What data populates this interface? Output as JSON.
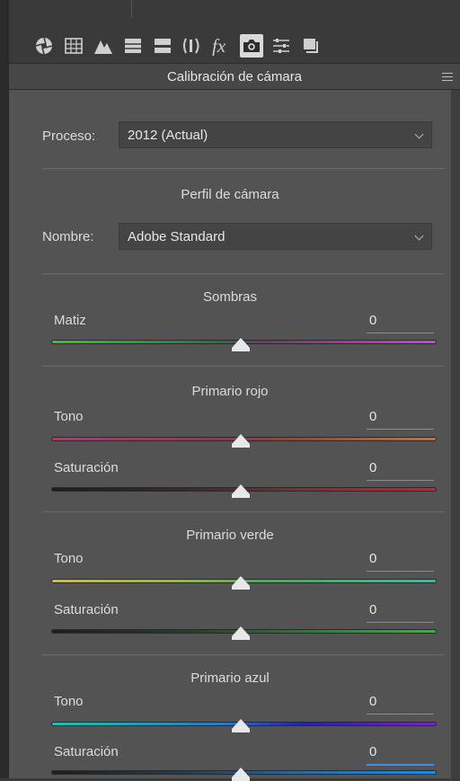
{
  "toolbar": {
    "icons": [
      "aperture-icon",
      "grid-icon",
      "mountain-icon",
      "hsl-icon",
      "split-tone-icon",
      "lens-icon",
      "fx-icon",
      "camera-icon",
      "presets-icon",
      "snapshots-icon"
    ],
    "active": "camera-icon"
  },
  "panel": {
    "title": "Calibración de cámara"
  },
  "process": {
    "label": "Proceso:",
    "value": "2012 (Actual)"
  },
  "profile": {
    "section": "Perfil de cámara",
    "label": "Nombre:",
    "value": "Adobe Standard"
  },
  "sombras": {
    "title": "Sombras",
    "matiz_label": "Matiz",
    "matiz_value": "0"
  },
  "rojo": {
    "title": "Primario rojo",
    "tono_label": "Tono",
    "tono_value": "0",
    "sat_label": "Saturación",
    "sat_value": "0"
  },
  "verde": {
    "title": "Primario verde",
    "tono_label": "Tono",
    "tono_value": "0",
    "sat_label": "Saturación",
    "sat_value": "0"
  },
  "azul": {
    "title": "Primario azul",
    "tono_label": "Tono",
    "tono_value": "0",
    "sat_label": "Saturación",
    "sat_value": "0"
  },
  "colors": {
    "focus": "#3d8ee6",
    "panel": "#535353"
  }
}
